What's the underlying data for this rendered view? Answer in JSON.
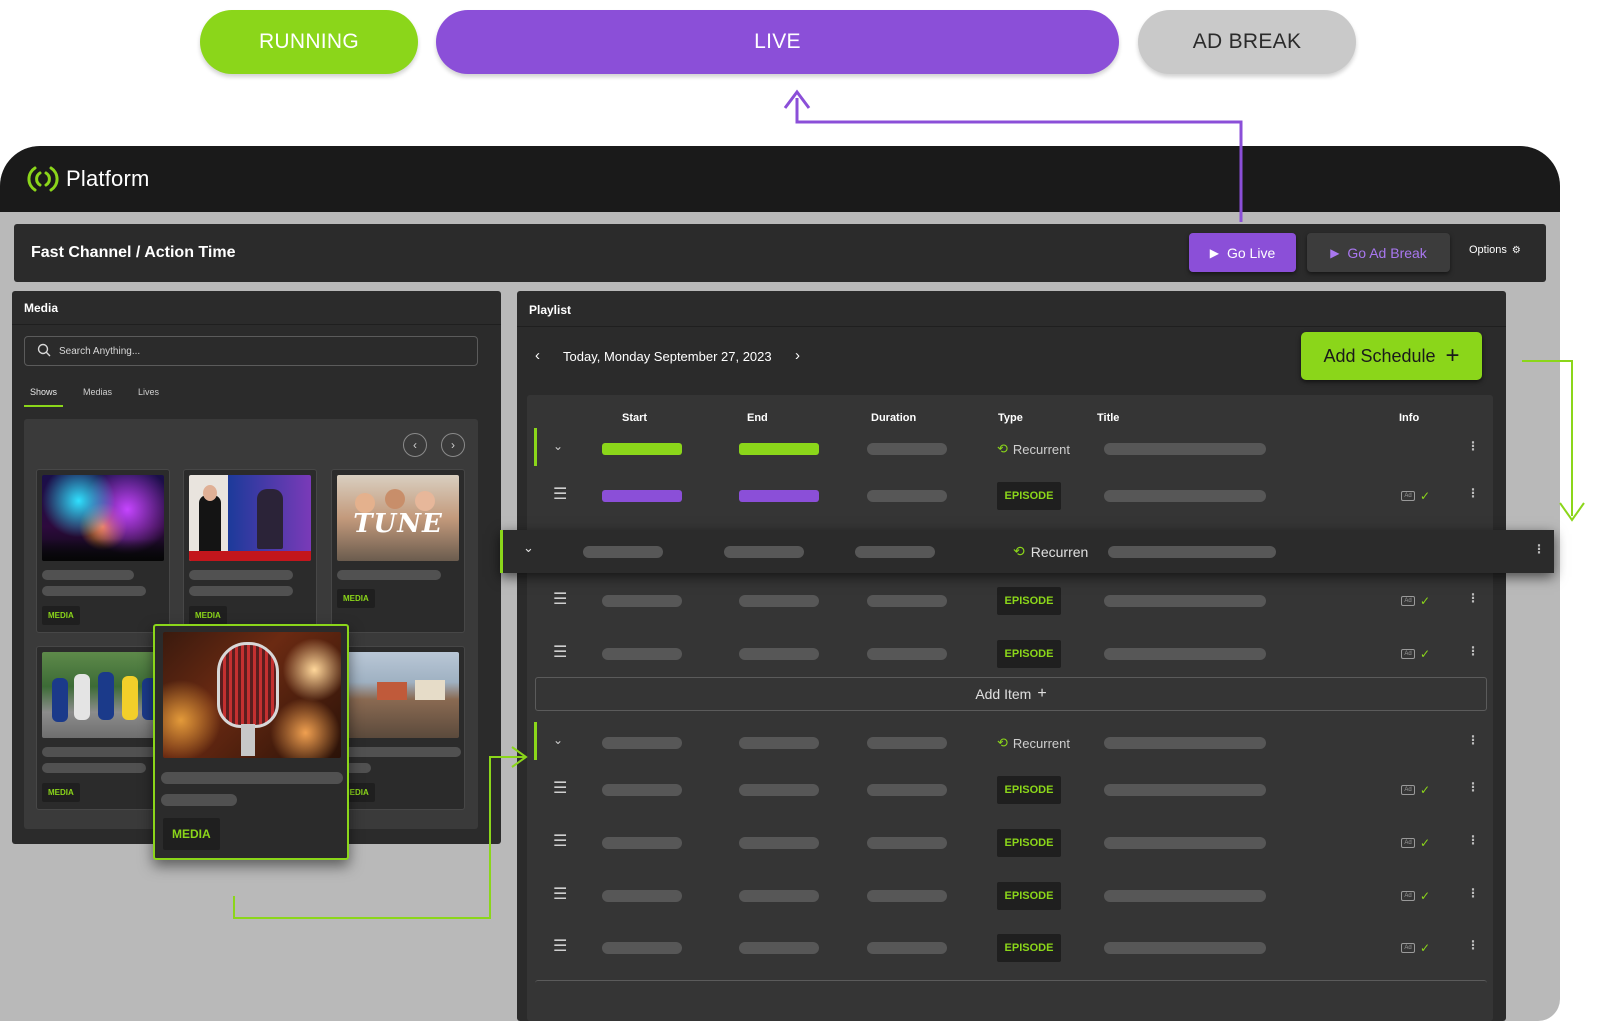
{
  "states": {
    "running": "RUNNING",
    "live": "LIVE",
    "ad_break": "AD BREAK"
  },
  "brand": {
    "name": "Platform",
    "accent": "#8bd61a",
    "live_color": "#8b4fd8"
  },
  "channel": {
    "title": "Fast Channel / Action Time",
    "go_live": "Go Live",
    "go_ad_break": "Go Ad Break",
    "options": "Options"
  },
  "media": {
    "title": "Media",
    "search_placeholder": "Search Anything...",
    "tabs": [
      "Shows",
      "Medias",
      "Lives"
    ],
    "badge": "MEDIA",
    "drag_badge": "MEDIA"
  },
  "playlist": {
    "title": "Playlist",
    "date": "Today, Monday September 27, 2023",
    "add_schedule": "Add Schedule",
    "columns": [
      "Start",
      "End",
      "Duration",
      "Type",
      "Title",
      "Info"
    ],
    "recurrent_label": "Recurrent",
    "dragged_recurrent_label": "Recurren",
    "episode_label": "EPISODE",
    "add_item": "Add Item"
  },
  "icons": [
    "logo-icon",
    "play-icon",
    "gear-icon",
    "search-icon",
    "chevron-left-icon",
    "chevron-right-icon",
    "plus-icon",
    "chevron-down-icon",
    "drag-handle-icon",
    "recurrent-icon",
    "ad-icon",
    "check-icon",
    "kebab-icon"
  ]
}
